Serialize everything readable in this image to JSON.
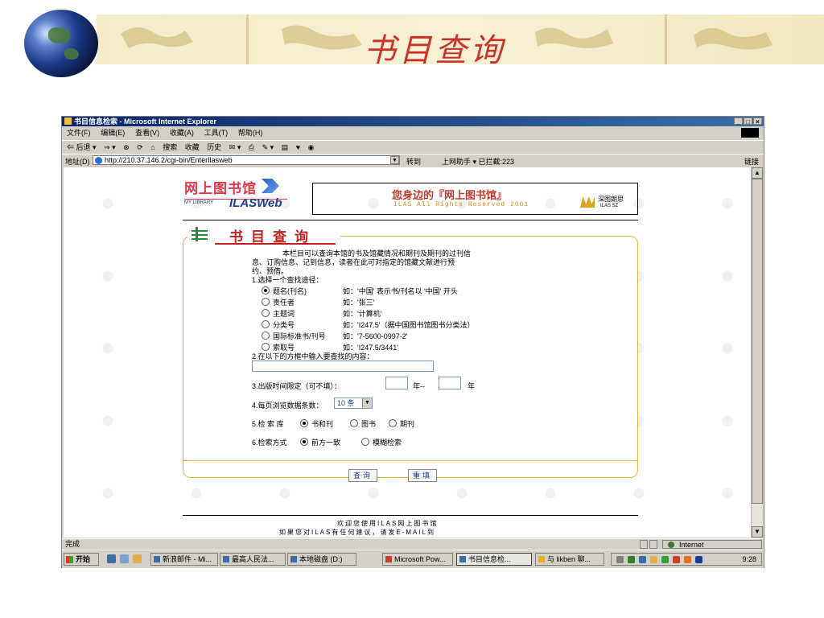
{
  "slide": {
    "title": "书目查询",
    "colors": {
      "title": "#c9342a",
      "band": "#f4ecc9"
    }
  },
  "window": {
    "title": "书目信息检索 - Microsoft Internet Explorer",
    "controls": [
      "_",
      "□",
      "×"
    ],
    "menu": [
      "文件(F)",
      "编辑(E)",
      "查看(V)",
      "收藏(A)",
      "工具(T)",
      "帮助(H)"
    ],
    "toolbar": [
      "⇐ 后退 ▾",
      "⇒ ▾",
      "⊗",
      "⟳",
      "⌂",
      "搜索",
      "收藏",
      "历史",
      "✉ ▾",
      "⎙",
      "✎ ▾",
      "▤",
      "♥",
      "◉"
    ],
    "address_label": "地址(D)",
    "address": "http://210.37.146.2/cgi-bin/EnterIlasweb",
    "go_label": "转到",
    "address_extra": "上网助手  ▾   已拦截:223",
    "links_label": "链接"
  },
  "page": {
    "logo": {
      "name": "网上图书馆",
      "sub": "MY LIBRARY",
      "brand": "ILASWeb"
    },
    "banner": {
      "main": "您身边的『网上图书馆』",
      "rights": "ILAS All Rights Reserved 2001",
      "company": "深图朗思",
      "company_sub": "ILAS  SZ"
    },
    "form": {
      "heading": "书目查询",
      "intro_1": "本栏目可以查询本馆的书及馆藏情况和期刊及期刊的过刊信",
      "intro_2": "息、订购信息、记到信息，读者在此可对指定的馆藏文献进行预",
      "intro_3": "约、预借。",
      "step1": "1.选择一个查找途径：",
      "options": [
        {
          "label": "题名(刊名)",
          "example": "如：'中国' 表示书/刊名以 '中国' 开头",
          "checked": true
        },
        {
          "label": "责任者",
          "example": "如：'张三'",
          "checked": false
        },
        {
          "label": "主题词",
          "example": "如：'计算机'",
          "checked": false
        },
        {
          "label": "分类号",
          "example": "如：'I247.5'（据中国图书馆图书分类法）",
          "checked": false
        },
        {
          "label": "国际标准书/刊号",
          "example": "如：'7-5600-0997-2'",
          "checked": false
        },
        {
          "label": "索取号",
          "example": "如：'I247.5/3441'",
          "checked": false
        }
      ],
      "step2": "2.在以下的方框中输入要查找的内容：",
      "step3": "3.出版时间限定（可不填）：",
      "year_to": "年--",
      "year": "年",
      "step4": "4.每页浏览数据条数：",
      "per_page": "10 条",
      "step5": "5.检 索 库",
      "db_options": [
        {
          "label": "书和刊",
          "checked": true
        },
        {
          "label": "图书",
          "checked": false
        },
        {
          "label": "期刊",
          "checked": false
        }
      ],
      "step6": "6.检索方式",
      "mode_options": [
        {
          "label": "前方一致",
          "checked": true
        },
        {
          "label": "模糊检索",
          "checked": false
        }
      ],
      "submit": "查询",
      "reset": "重填"
    },
    "footer_1": "欢迎您使用ILAS网上图书馆",
    "footer_2": "如果您对ILAS有任何建议，请发E-MAIL到"
  },
  "statusbar": {
    "text": "完成",
    "zone": "Internet"
  },
  "taskbar": {
    "start": "开始",
    "tasks": [
      {
        "label": "新浪邮件 - Mi...",
        "active": false
      },
      {
        "label": "最高人民法...",
        "active": false
      },
      {
        "label": "本地磁盘 (D:)",
        "active": false
      },
      {
        "label": "Microsoft Pow...",
        "active": false
      },
      {
        "label": "书目信息检...",
        "active": true
      },
      {
        "label": "与 likben 聊...",
        "active": false
      }
    ],
    "clock": "9:28"
  }
}
